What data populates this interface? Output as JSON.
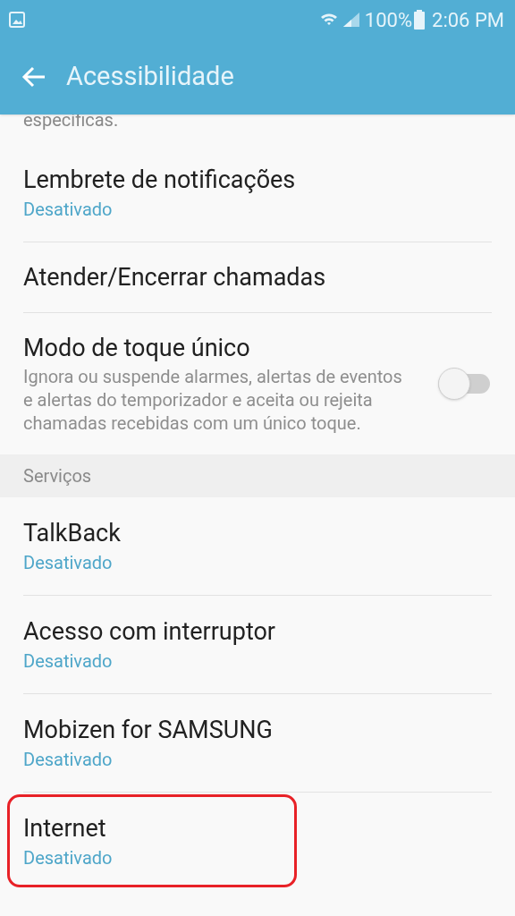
{
  "status_bar": {
    "battery": "100%",
    "time": "2:06 PM"
  },
  "app_bar": {
    "title": "Acessibilidade"
  },
  "cut_text": "específicas.",
  "items": [
    {
      "kind": "item",
      "title": "Lembrete de notificações",
      "summary": "Desativado"
    },
    {
      "kind": "item",
      "title": "Atender/Encerrar chamadas"
    },
    {
      "kind": "switch",
      "title": "Modo de toque único",
      "description": "Ignora ou suspende alarmes, alertas de eventos e alertas do temporizador e aceita ou rejeita chamadas recebidas com um único toque.",
      "on": false
    },
    {
      "kind": "header",
      "title": "Serviços"
    },
    {
      "kind": "item",
      "title": "TalkBack",
      "summary": "Desativado"
    },
    {
      "kind": "item",
      "title": "Acesso com interruptor",
      "summary": "Desativado"
    },
    {
      "kind": "item",
      "title": "Mobizen for SAMSUNG",
      "summary": "Desativado"
    },
    {
      "kind": "item",
      "title": "Internet",
      "summary": "Desativado",
      "highlighted": true
    }
  ]
}
